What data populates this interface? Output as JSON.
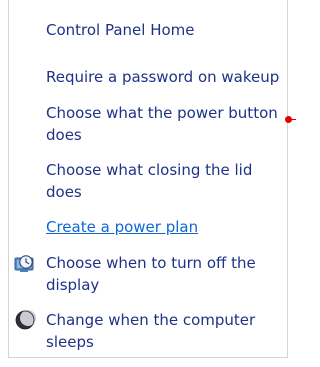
{
  "nav": {
    "home": "Control Panel Home",
    "wake": "Require a password on wakeup",
    "power_button": "Choose what the power button does",
    "lid": "Choose what closing the lid does",
    "plan": "Create a power plan",
    "display": "Choose when to turn off the display",
    "sleep": "Change when the computer sleeps"
  },
  "icons": {
    "display": "clock-monitor-icon",
    "sleep": "moon-icon"
  },
  "colors": {
    "text": "#1e3287",
    "link": "#0f67d6",
    "marker": "#e30000"
  }
}
